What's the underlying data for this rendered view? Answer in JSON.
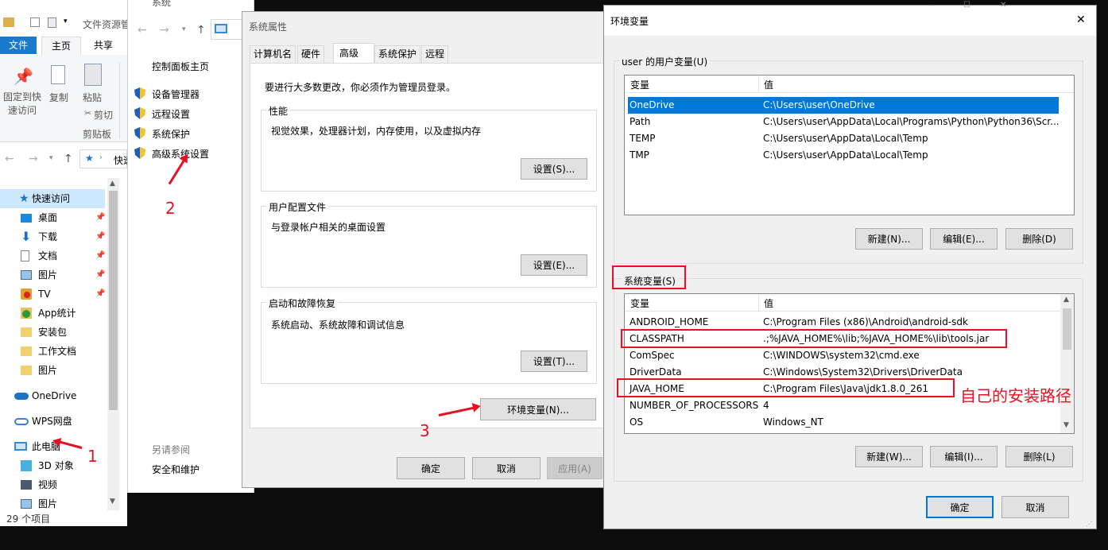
{
  "explorer": {
    "title": "文件资源管",
    "ribbon_tabs": [
      "文件",
      "主页",
      "共享"
    ],
    "ribbon_buttons": {
      "pin": "固定到快速访问",
      "pin_line1": "固定到快",
      "pin_line2": "速访问",
      "copy": "复制",
      "paste": "粘贴",
      "cut": "剪切",
      "group_label": "剪贴板"
    },
    "address": "快速",
    "nav": [
      {
        "label": "快速访问",
        "icon": "star-icon"
      },
      {
        "label": "桌面",
        "icon": "desktop-icon"
      },
      {
        "label": "下载",
        "icon": "download-icon"
      },
      {
        "label": "文档",
        "icon": "document-icon"
      },
      {
        "label": "图片",
        "icon": "picture-icon"
      },
      {
        "label": "TV",
        "icon": "tv-icon"
      },
      {
        "label": "App统计",
        "icon": "check-folder-icon"
      },
      {
        "label": "安装包",
        "icon": "folder-icon"
      },
      {
        "label": "工作文档",
        "icon": "folder-icon"
      },
      {
        "label": "图片",
        "icon": "folder-icon"
      },
      {
        "label": "OneDrive",
        "icon": "cloud-icon"
      },
      {
        "label": "WPS网盘",
        "icon": "wps-cloud-icon"
      },
      {
        "label": "此电脑",
        "icon": "computer-icon"
      },
      {
        "label": "3D 对象",
        "icon": "cube-icon"
      },
      {
        "label": "视频",
        "icon": "video-icon"
      },
      {
        "label": "图片",
        "icon": "picture-icon"
      }
    ],
    "status": "29 个项目"
  },
  "system": {
    "title": "系统",
    "control_panel_home": "控制面板主页",
    "links": [
      "设备管理器",
      "远程设置",
      "系统保护",
      "高级系统设置"
    ],
    "see_also": "另请参阅",
    "security": "安全和维护"
  },
  "sysprops": {
    "title": "系统属性",
    "tabs": [
      "计算机名",
      "硬件",
      "高级",
      "系统保护",
      "远程"
    ],
    "admin_note": "要进行大多数更改，你必须作为管理员登录。",
    "perf_title": "性能",
    "perf_desc": "视觉效果，处理器计划，内存使用，以及虚拟内存",
    "perf_btn": "设置(S)...",
    "profile_title": "用户配置文件",
    "profile_desc": "与登录帐户相关的桌面设置",
    "profile_btn": "设置(E)...",
    "startup_title": "启动和故障恢复",
    "startup_desc": "系统启动、系统故障和调试信息",
    "startup_btn": "设置(T)...",
    "env_btn": "环境变量(N)...",
    "ok": "确定",
    "cancel": "取消",
    "apply": "应用(A)"
  },
  "envvars": {
    "title": "环境变量",
    "close": "✕",
    "user_group": "user 的用户变量(U)",
    "col_var": "变量",
    "col_val": "值",
    "user_rows": [
      {
        "name": "OneDrive",
        "value": "C:\\Users\\user\\OneDrive"
      },
      {
        "name": "Path",
        "value": "C:\\Users\\user\\AppData\\Local\\Programs\\Python\\Python36\\Scr..."
      },
      {
        "name": "TEMP",
        "value": "C:\\Users\\user\\AppData\\Local\\Temp"
      },
      {
        "name": "TMP",
        "value": "C:\\Users\\user\\AppData\\Local\\Temp"
      }
    ],
    "new_user": "新建(N)...",
    "edit_user": "编辑(E)...",
    "del_user": "删除(D)",
    "sys_group": "系统变量(S)",
    "sys_rows": [
      {
        "name": "ANDROID_HOME",
        "value": "C:\\Program Files (x86)\\Android\\android-sdk"
      },
      {
        "name": "CLASSPATH",
        "value": ".;%JAVA_HOME%\\lib;%JAVA_HOME%\\lib\\tools.jar"
      },
      {
        "name": "ComSpec",
        "value": "C:\\WINDOWS\\system32\\cmd.exe"
      },
      {
        "name": "DriverData",
        "value": "C:\\Windows\\System32\\Drivers\\DriverData"
      },
      {
        "name": "JAVA_HOME",
        "value": "C:\\Program Files\\Java\\jdk1.8.0_261"
      },
      {
        "name": "NUMBER_OF_PROCESSORS",
        "value": "4"
      },
      {
        "name": "OS",
        "value": "Windows_NT"
      }
    ],
    "new_sys": "新建(W)...",
    "edit_sys": "编辑(I)...",
    "del_sys": "删除(L)",
    "ok": "确定",
    "cancel": "取消"
  },
  "annotations": {
    "step1": "1",
    "step2": "2",
    "step3": "3",
    "note": "自己的安装路径"
  }
}
